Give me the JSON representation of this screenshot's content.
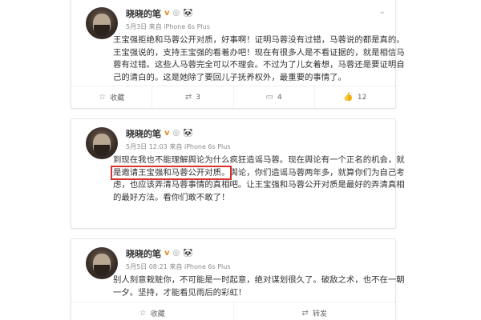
{
  "colors": {
    "highlight": "#d9322f",
    "vip": "#e8891d",
    "muted": "#8a8a8a"
  },
  "posts": [
    {
      "author": "晓晓的笔",
      "badges": {
        "vip": "v",
        "medal": "◎",
        "panda": "🐼"
      },
      "meta": "5月3日 来自 iPhone 6s Plus",
      "lines": [
        "王宝强拒绝和马蓉公开对质，好事啊！证明马蓉没有过错，马蓉说的都是真的。",
        "王宝强说的，支持王宝强的看着办吧！现在有很多人是不看证据的，就是相信马",
        "蓉有过错。这些人马蓉完全可以不理会。不过为了儿女着想，马蓉还是要证明自",
        "己的清白的。这是她除了要回儿子抚养权外，最重要的事情了。"
      ],
      "actions": {
        "fav": "收藏",
        "repost": "3",
        "comment": "4",
        "like": "12"
      }
    },
    {
      "author": "晓晓的笔",
      "badges": {
        "vip": "v",
        "medal": "◎",
        "panda": "🐼"
      },
      "meta": "5月3日 12:03 来自 iPhone 6s Plus",
      "line1": "到现在我也不能理解舆论为什么疯狂造谣马蓉。现在舆论有一个正名的机会，就",
      "line2_highlight": "是邀请王宝强和马蓉公开对质。",
      "line2_rest": "舆论，你们造谣马蓉两年多，就算你们为自己考",
      "line3": "虑，也应该弄清马蓉事情的真相吧。让王宝强和马蓉公开对质是最好的弄清真相",
      "line4": "的最好方法。看你们敢不敢了！"
    },
    {
      "author": "晓晓的笔",
      "badges": {
        "vip": "v",
        "medal": "◎",
        "panda": "🐼"
      },
      "meta": "5月5日 08:21 来自 iPhone 6s Plus",
      "lines": [
        "别人刻意栽赃你，不可能是一时起意，绝对谋划很久了。破敌之术，也不在一朝",
        "一夕。坚持，才能看见雨后的彩虹！"
      ],
      "actions": {
        "fav": "收藏",
        "repost": "转发"
      }
    }
  ]
}
